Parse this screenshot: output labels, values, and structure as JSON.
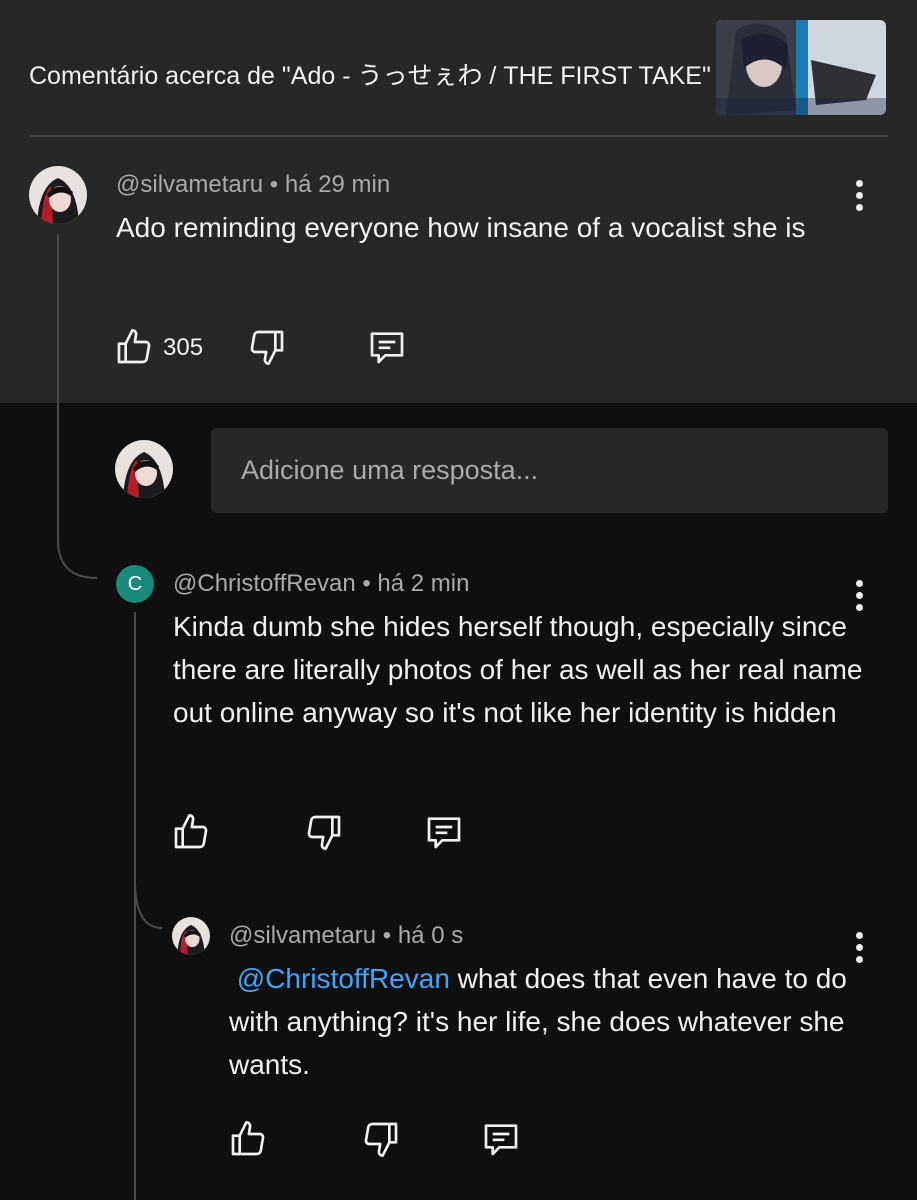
{
  "header": {
    "title": "Comentário acerca de \"Ado - うっせぇわ / THE FIRST TAKE\"",
    "thumbnail_alt": "video-thumbnail"
  },
  "comment": {
    "author": "@silvametaru",
    "time": "há 29 min",
    "text": "Ado reminding everyone how insane of a vocalist she is",
    "likes": "305"
  },
  "reply_input": {
    "placeholder": "Adicione uma resposta..."
  },
  "replies": [
    {
      "avatar_letter": "C",
      "author": "@ChristoffRevan",
      "time": "há 2 min",
      "text": "Kinda dumb she hides herself though, especially since there are literally photos of her as well as her real name out online anyway so it's not like her identity is hidden"
    },
    {
      "author": "@silvametaru",
      "time": "há 0 s",
      "mention": "@ChristoffRevan",
      "text": " what does that even have to do with anything? it's her life, she does whatever she wants."
    }
  ],
  "separator": " • ",
  "colors": {
    "panel": "#272727",
    "background": "#0f0f0f",
    "mention": "#3ea6ff",
    "meta": "#aaaaaa"
  }
}
